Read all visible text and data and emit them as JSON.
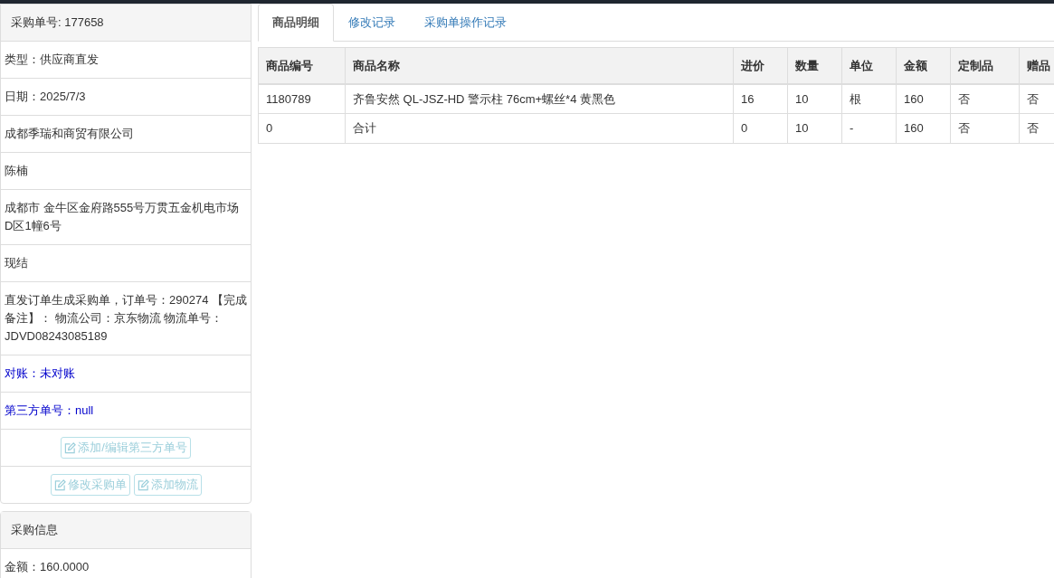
{
  "order_panel": {
    "title": "采购单号: 177658",
    "rows": [
      {
        "kind": "plain",
        "text": "类型：供应商直发"
      },
      {
        "kind": "plain",
        "text": "日期：2025/7/3"
      },
      {
        "kind": "plain",
        "text": "成都季瑞和商贸有限公司"
      },
      {
        "kind": "plain",
        "text": "陈楠"
      },
      {
        "kind": "plain",
        "text": "成都市 金牛区金府路555号万贯五金机电市场D区1幢6号"
      },
      {
        "kind": "plain",
        "text": "现结"
      },
      {
        "kind": "plain",
        "text": "直发订单生成采购单，订单号：290274 【完成备注】： 物流公司：京东物流 物流单号：JDVD08243085189"
      },
      {
        "kind": "link",
        "text": "对账：未对账"
      },
      {
        "kind": "link",
        "text": "第三方单号：null"
      }
    ],
    "button_rows": [
      [
        {
          "label": "添加/编辑第三方单号",
          "disabled": true
        }
      ],
      [
        {
          "label": "修改采购单",
          "disabled": true
        },
        {
          "label": "添加物流",
          "disabled": true
        }
      ]
    ]
  },
  "purchase_panel": {
    "title": "采购信息",
    "rows": [
      {
        "text": "金额：160.0000"
      }
    ]
  },
  "tabs": [
    {
      "label": "商品明细",
      "selected": true
    },
    {
      "label": "修改记录",
      "selected": false
    },
    {
      "label": "采购单操作记录",
      "selected": false
    }
  ],
  "table": {
    "columns": [
      "商品编号",
      "商品名称",
      "进价",
      "数量",
      "单位",
      "金额",
      "定制品",
      "赠品"
    ],
    "rows": [
      [
        "1180789",
        "齐鲁安然 QL-JSZ-HD 警示柱 76cm+螺丝*4 黄黑色",
        "16",
        "10",
        "根",
        "160",
        "否",
        "否"
      ],
      [
        "0",
        "合计",
        "0",
        "10",
        "-",
        "160",
        "否",
        "否"
      ]
    ]
  }
}
